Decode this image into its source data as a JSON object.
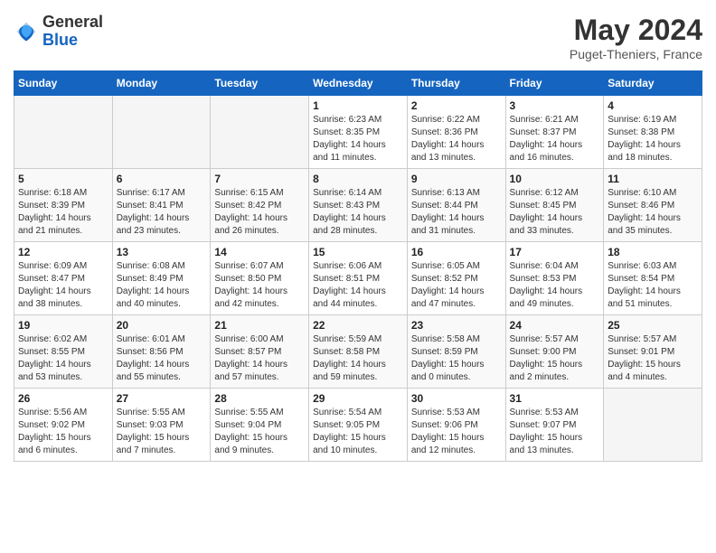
{
  "header": {
    "logo": {
      "general": "General",
      "blue": "Blue"
    },
    "title": "May 2024",
    "subtitle": "Puget-Theniers, France"
  },
  "calendar": {
    "days_of_week": [
      "Sunday",
      "Monday",
      "Tuesday",
      "Wednesday",
      "Thursday",
      "Friday",
      "Saturday"
    ],
    "weeks": [
      [
        {
          "day": "",
          "info": ""
        },
        {
          "day": "",
          "info": ""
        },
        {
          "day": "",
          "info": ""
        },
        {
          "day": "1",
          "info": "Sunrise: 6:23 AM\nSunset: 8:35 PM\nDaylight: 14 hours and 11 minutes."
        },
        {
          "day": "2",
          "info": "Sunrise: 6:22 AM\nSunset: 8:36 PM\nDaylight: 14 hours and 13 minutes."
        },
        {
          "day": "3",
          "info": "Sunrise: 6:21 AM\nSunset: 8:37 PM\nDaylight: 14 hours and 16 minutes."
        },
        {
          "day": "4",
          "info": "Sunrise: 6:19 AM\nSunset: 8:38 PM\nDaylight: 14 hours and 18 minutes."
        }
      ],
      [
        {
          "day": "5",
          "info": "Sunrise: 6:18 AM\nSunset: 8:39 PM\nDaylight: 14 hours and 21 minutes."
        },
        {
          "day": "6",
          "info": "Sunrise: 6:17 AM\nSunset: 8:41 PM\nDaylight: 14 hours and 23 minutes."
        },
        {
          "day": "7",
          "info": "Sunrise: 6:15 AM\nSunset: 8:42 PM\nDaylight: 14 hours and 26 minutes."
        },
        {
          "day": "8",
          "info": "Sunrise: 6:14 AM\nSunset: 8:43 PM\nDaylight: 14 hours and 28 minutes."
        },
        {
          "day": "9",
          "info": "Sunrise: 6:13 AM\nSunset: 8:44 PM\nDaylight: 14 hours and 31 minutes."
        },
        {
          "day": "10",
          "info": "Sunrise: 6:12 AM\nSunset: 8:45 PM\nDaylight: 14 hours and 33 minutes."
        },
        {
          "day": "11",
          "info": "Sunrise: 6:10 AM\nSunset: 8:46 PM\nDaylight: 14 hours and 35 minutes."
        }
      ],
      [
        {
          "day": "12",
          "info": "Sunrise: 6:09 AM\nSunset: 8:47 PM\nDaylight: 14 hours and 38 minutes."
        },
        {
          "day": "13",
          "info": "Sunrise: 6:08 AM\nSunset: 8:49 PM\nDaylight: 14 hours and 40 minutes."
        },
        {
          "day": "14",
          "info": "Sunrise: 6:07 AM\nSunset: 8:50 PM\nDaylight: 14 hours and 42 minutes."
        },
        {
          "day": "15",
          "info": "Sunrise: 6:06 AM\nSunset: 8:51 PM\nDaylight: 14 hours and 44 minutes."
        },
        {
          "day": "16",
          "info": "Sunrise: 6:05 AM\nSunset: 8:52 PM\nDaylight: 14 hours and 47 minutes."
        },
        {
          "day": "17",
          "info": "Sunrise: 6:04 AM\nSunset: 8:53 PM\nDaylight: 14 hours and 49 minutes."
        },
        {
          "day": "18",
          "info": "Sunrise: 6:03 AM\nSunset: 8:54 PM\nDaylight: 14 hours and 51 minutes."
        }
      ],
      [
        {
          "day": "19",
          "info": "Sunrise: 6:02 AM\nSunset: 8:55 PM\nDaylight: 14 hours and 53 minutes."
        },
        {
          "day": "20",
          "info": "Sunrise: 6:01 AM\nSunset: 8:56 PM\nDaylight: 14 hours and 55 minutes."
        },
        {
          "day": "21",
          "info": "Sunrise: 6:00 AM\nSunset: 8:57 PM\nDaylight: 14 hours and 57 minutes."
        },
        {
          "day": "22",
          "info": "Sunrise: 5:59 AM\nSunset: 8:58 PM\nDaylight: 14 hours and 59 minutes."
        },
        {
          "day": "23",
          "info": "Sunrise: 5:58 AM\nSunset: 8:59 PM\nDaylight: 15 hours and 0 minutes."
        },
        {
          "day": "24",
          "info": "Sunrise: 5:57 AM\nSunset: 9:00 PM\nDaylight: 15 hours and 2 minutes."
        },
        {
          "day": "25",
          "info": "Sunrise: 5:57 AM\nSunset: 9:01 PM\nDaylight: 15 hours and 4 minutes."
        }
      ],
      [
        {
          "day": "26",
          "info": "Sunrise: 5:56 AM\nSunset: 9:02 PM\nDaylight: 15 hours and 6 minutes."
        },
        {
          "day": "27",
          "info": "Sunrise: 5:55 AM\nSunset: 9:03 PM\nDaylight: 15 hours and 7 minutes."
        },
        {
          "day": "28",
          "info": "Sunrise: 5:55 AM\nSunset: 9:04 PM\nDaylight: 15 hours and 9 minutes."
        },
        {
          "day": "29",
          "info": "Sunrise: 5:54 AM\nSunset: 9:05 PM\nDaylight: 15 hours and 10 minutes."
        },
        {
          "day": "30",
          "info": "Sunrise: 5:53 AM\nSunset: 9:06 PM\nDaylight: 15 hours and 12 minutes."
        },
        {
          "day": "31",
          "info": "Sunrise: 5:53 AM\nSunset: 9:07 PM\nDaylight: 15 hours and 13 minutes."
        },
        {
          "day": "",
          "info": ""
        }
      ]
    ]
  }
}
